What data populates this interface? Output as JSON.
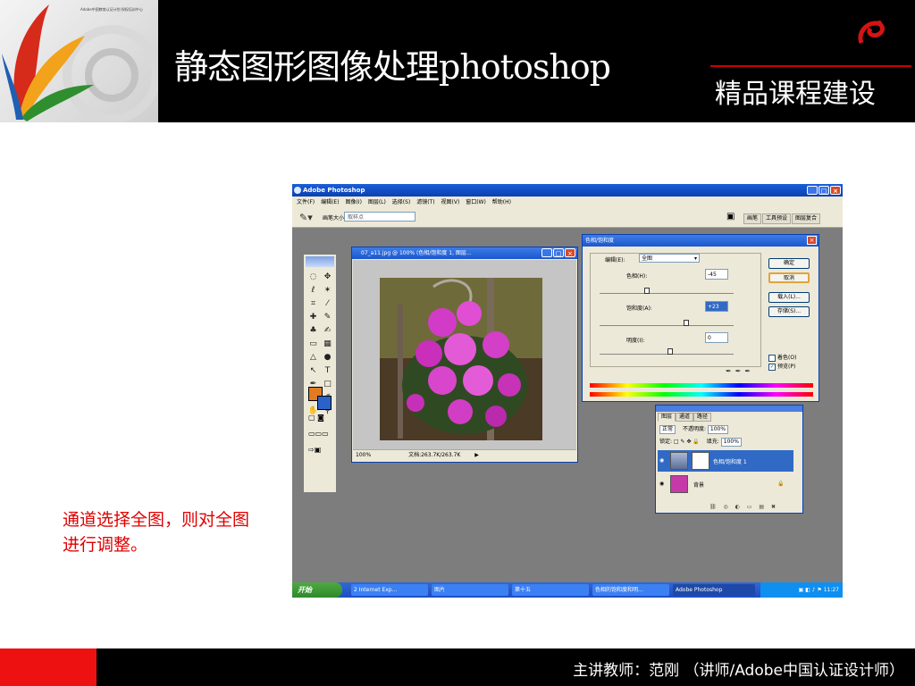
{
  "slide": {
    "title": "静态图形图像处理photoshop",
    "brand": "精品课程建设",
    "caption": "通道选择全图，则对全图进行调整。",
    "footer": "主讲教师：范刚 （讲师/Adobe中国认证设计师）"
  },
  "photoshop": {
    "title": "Adobe Photoshop",
    "menu": [
      "文件(F)",
      "编辑(E)",
      "图像(I)",
      "图层(L)",
      "选择(S)",
      "滤镜(T)",
      "视图(V)",
      "窗口(W)",
      "帮助(H)"
    ],
    "options": {
      "brush_label": "画笔大小:",
      "sample_value": "取样点"
    },
    "palette_wells": [
      "画笔",
      "工具预设",
      "图层复合"
    ],
    "document": {
      "title": "07_a11.jpg @ 100% (色相/饱和度 1, 图层...",
      "zoom": "100%",
      "doc_info": "文档:263.7K/263.7K"
    },
    "hue_sat": {
      "title": "色相/饱和度",
      "edit_label": "编辑(E):",
      "edit_value": "全图",
      "hue_label": "色相(H):",
      "hue_value": "-45",
      "saturation_label": "饱和度(A):",
      "saturation_value": "+23",
      "lightness_label": "明度(I):",
      "lightness_value": "0",
      "ok": "确定",
      "cancel": "取消",
      "load": "载入(L)...",
      "save": "存储(S)...",
      "colorize": "着色(O)",
      "preview": "预览(P)"
    },
    "layers": {
      "tabs": [
        "图层",
        "通道",
        "路径"
      ],
      "blend_mode": "正常",
      "opacity_label": "不透明度:",
      "opacity_value": "100%",
      "lock_label": "锁定:",
      "fill_label": "填充:",
      "fill_value": "100%",
      "items": [
        {
          "name": "色相/饱和度 1"
        },
        {
          "name": "背景"
        }
      ]
    },
    "taskbar": {
      "start": "开始",
      "tasks": [
        "2 Internet Exp...",
        "图片",
        "第十五",
        "色相的饱和度和明...",
        "Adobe Photoshop"
      ],
      "clock": "11:27"
    }
  }
}
